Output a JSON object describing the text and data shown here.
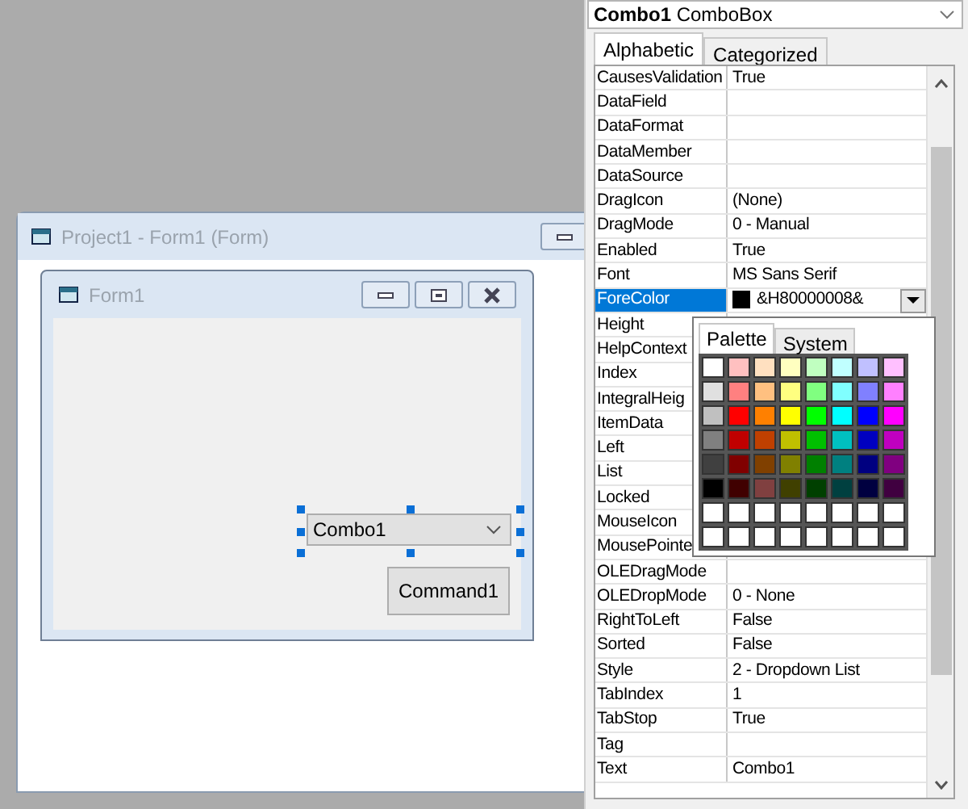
{
  "designer": {
    "title": "Project1 - Form1 (Form)",
    "form": {
      "title": "Form1",
      "combo": {
        "text": "Combo1",
        "selected": true
      },
      "button": "Command1"
    }
  },
  "properties": {
    "object_name": "Combo1",
    "object_type": "ComboBox",
    "tabs": [
      {
        "label": "Alphabetic",
        "selected": true
      },
      {
        "label": "Categorized",
        "selected": false
      }
    ],
    "rows": [
      {
        "name": "CausesValidation",
        "value": "True",
        "selected": false
      },
      {
        "name": "DataField",
        "selected": false
      },
      {
        "name": "DataFormat",
        "selected": false
      },
      {
        "name": "DataMember",
        "selected": false
      },
      {
        "name": "DataSource",
        "selected": false
      },
      {
        "name": "DragIcon",
        "value": "(None)",
        "selected": false
      },
      {
        "name": "DragMode",
        "value": "0 - Manual",
        "selected": false
      },
      {
        "name": "Enabled",
        "value": "True",
        "selected": false
      },
      {
        "name": "Font",
        "value": "MS Sans Serif",
        "selected": false
      },
      {
        "name": "ForeColor",
        "value": "&H80000008&",
        "color": "#000000",
        "selected": true
      },
      {
        "name": "Height",
        "selected": false
      },
      {
        "name": "HelpContext",
        "selected": false
      },
      {
        "name": "Index",
        "selected": false
      },
      {
        "name": "IntegralHeig",
        "selected": false
      },
      {
        "name": "ItemData",
        "selected": false
      },
      {
        "name": "Left",
        "selected": false
      },
      {
        "name": "List",
        "selected": false
      },
      {
        "name": "Locked",
        "selected": false
      },
      {
        "name": "MouseIcon",
        "selected": false
      },
      {
        "name": "MousePointe",
        "selected": false
      },
      {
        "name": "OLEDragMode",
        "selected": false
      },
      {
        "name": "OLEDropMode",
        "value": "0 - None",
        "selected": false
      },
      {
        "name": "RightToLeft",
        "value": "False",
        "selected": false
      },
      {
        "name": "Sorted",
        "value": "False",
        "selected": false
      },
      {
        "name": "Style",
        "value": "2 - Dropdown List",
        "selected": false
      },
      {
        "name": "TabIndex",
        "value": "1",
        "selected": false
      },
      {
        "name": "TabStop",
        "value": "True",
        "selected": false
      },
      {
        "name": "Tag",
        "selected": false
      },
      {
        "name": "Text",
        "value": "Combo1",
        "selected": false
      }
    ],
    "color_picker": {
      "tabs": [
        {
          "label": "Palette",
          "selected": true
        },
        {
          "label": "System",
          "selected": false
        }
      ],
      "swatches": [
        {
          "color": "#ffffff"
        },
        {
          "color": "#ffc0c0"
        },
        {
          "color": "#ffe0c0"
        },
        {
          "color": "#ffffc0"
        },
        {
          "color": "#c0ffc0"
        },
        {
          "color": "#c0ffff"
        },
        {
          "color": "#c0c0ff"
        },
        {
          "color": "#ffc0ff"
        },
        {
          "color": "#e0e0e0"
        },
        {
          "color": "#ff8080"
        },
        {
          "color": "#ffc080"
        },
        {
          "color": "#ffff80"
        },
        {
          "color": "#80ff80"
        },
        {
          "color": "#80ffff"
        },
        {
          "color": "#8080ff"
        },
        {
          "color": "#ff80ff"
        },
        {
          "color": "#c0c0c0"
        },
        {
          "color": "#ff0000"
        },
        {
          "color": "#ff8000"
        },
        {
          "color": "#ffff00"
        },
        {
          "color": "#00ff00"
        },
        {
          "color": "#00ffff"
        },
        {
          "color": "#0000ff"
        },
        {
          "color": "#ff00ff"
        },
        {
          "color": "#808080"
        },
        {
          "color": "#c00000"
        },
        {
          "color": "#c04000"
        },
        {
          "color": "#c0c000"
        },
        {
          "color": "#00c000"
        },
        {
          "color": "#00c0c0"
        },
        {
          "color": "#0000c0"
        },
        {
          "color": "#c000c0"
        },
        {
          "color": "#404040"
        },
        {
          "color": "#800000"
        },
        {
          "color": "#804000"
        },
        {
          "color": "#808000"
        },
        {
          "color": "#008000"
        },
        {
          "color": "#008080"
        },
        {
          "color": "#000080"
        },
        {
          "color": "#800080"
        },
        {
          "color": "#000000"
        },
        {
          "color": "#400000"
        },
        {
          "color": "#804040"
        },
        {
          "color": "#404000"
        },
        {
          "color": "#004000"
        },
        {
          "color": "#004040"
        },
        {
          "color": "#000040"
        },
        {
          "color": "#400040"
        },
        {
          "color": "#ffffff"
        },
        {
          "color": "#ffffff"
        },
        {
          "color": "#ffffff"
        },
        {
          "color": "#ffffff"
        },
        {
          "color": "#ffffff"
        },
        {
          "color": "#ffffff"
        },
        {
          "color": "#ffffff"
        },
        {
          "color": "#ffffff"
        },
        {
          "color": "#ffffff"
        },
        {
          "color": "#ffffff"
        },
        {
          "color": "#ffffff"
        },
        {
          "color": "#ffffff"
        },
        {
          "color": "#ffffff"
        },
        {
          "color": "#ffffff"
        },
        {
          "color": "#ffffff"
        },
        {
          "color": "#ffffff"
        }
      ]
    }
  }
}
